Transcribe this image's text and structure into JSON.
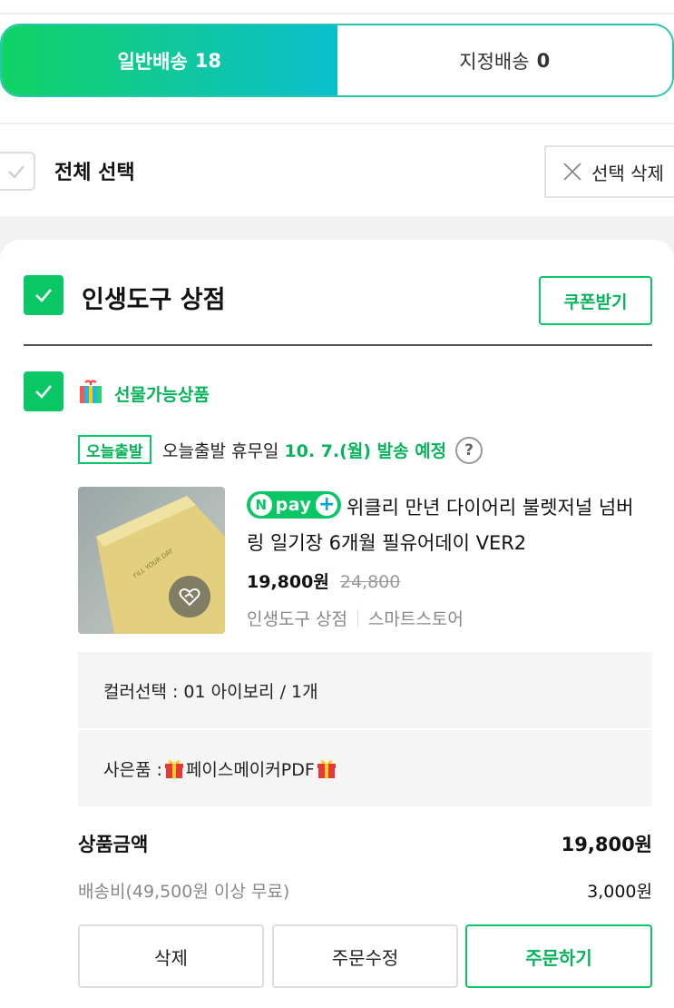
{
  "tabs": [
    {
      "label": "일반배송",
      "count": "18"
    },
    {
      "label": "지정배송",
      "count": "0"
    }
  ],
  "select_all": {
    "label": "전체 선택",
    "delete_label": "선택 삭제"
  },
  "store": {
    "name": "인생도구 상점",
    "coupon_label": "쿠폰받기"
  },
  "gift_label": "선물가능상품",
  "shipping": {
    "badge": "오늘출발",
    "text": "오늘출발 휴무일",
    "date": "10. 7.(월) 발송 예정",
    "help": "?"
  },
  "product": {
    "npay_n": "N",
    "npay_text": "pay",
    "npay_plus": "+",
    "title": "위클리 만년 다이어리 불렛저널 넘버링 일기장 6개월 필유어데이 VER2",
    "price": "19,800원",
    "original_price": "24,800",
    "seller": "인생도구 상점",
    "store_type": "스마트스토어",
    "thumb_text": "FILL YOUR DAY"
  },
  "options": {
    "color": "컬러선택 : 01 아이보리 / 1개",
    "gift_prefix": "사은품 : ",
    "gift_name": "페이스메이커PDF"
  },
  "summary": {
    "product_label": "상품금액",
    "product_value": "19,800원",
    "shipping_label": "배송비(49,500원 이상 무료)",
    "shipping_value": "3,000원"
  },
  "buttons": {
    "delete": "삭제",
    "edit": "주문수정",
    "order": "주문하기"
  },
  "colors": {
    "accent": "#09c765",
    "accent_text": "#09b35c",
    "tab_gradient_end": "#0bbfcd"
  },
  "icons": [
    "checkmark-icon",
    "close-icon",
    "gift-store-icon",
    "help-icon",
    "heart-icon",
    "gift-box-icon"
  ]
}
